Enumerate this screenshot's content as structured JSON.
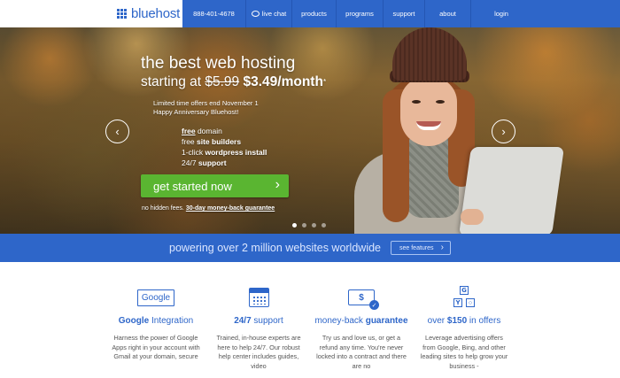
{
  "header": {
    "logo_text": "bluehost",
    "nav": {
      "phone": "888-401-4678",
      "chat": "live chat",
      "products": "products",
      "programs": "programs",
      "support": "support",
      "about": "about",
      "login": "login"
    }
  },
  "hero": {
    "title": "the best web hosting",
    "starting_at": "starting at",
    "old_price": "$5.99",
    "new_price": "$3.49/month",
    "star": "*",
    "offer_line1": "Limited time offers end November 1",
    "offer_line2": "Happy Anniversary Bluehost!",
    "features": [
      {
        "strong": "free",
        "text": " domain"
      },
      {
        "pre": "free ",
        "strong": "site builders"
      },
      {
        "pre": "1-click ",
        "strong": "wordpress install"
      },
      {
        "pre": "24/7 ",
        "strong": "support"
      }
    ],
    "cta_label": "get started now",
    "guarantee_prefix": "no hidden fees.",
    "guarantee_link": "30-day money-back guarantee",
    "slide_count": 4,
    "active_slide": 1
  },
  "band": {
    "text": "powering over 2 million websites worldwide",
    "button_label": "see features"
  },
  "features_row": [
    {
      "icon": "google-icon",
      "icon_text": "Google",
      "title_strong": "Google",
      "title_rest": " Integration",
      "body": "Harness the power of Google Apps right in your account with Gmail at your domain, secure"
    },
    {
      "icon": "calendar-icon",
      "title_strong": "24/7",
      "title_rest": " support",
      "body": "Trained, in-house experts are here to help 24/7. Our robust help center includes guides, video"
    },
    {
      "icon": "money-icon",
      "icon_text": "$",
      "title_pre": "money-back ",
      "title_strong": "guarantee",
      "body": "Try us and love us, or get a refund any time. You're never locked into a contract and there are no"
    },
    {
      "icon": "offers-icon",
      "title_pre": "over ",
      "title_strong": "$150",
      "title_rest": " in offers",
      "body": "Leverage advertising offers from Google, Bing, and other leading sites to help grow your business -"
    }
  ],
  "colors": {
    "brand_blue": "#2e66c9",
    "cta_green": "#5ab531"
  }
}
